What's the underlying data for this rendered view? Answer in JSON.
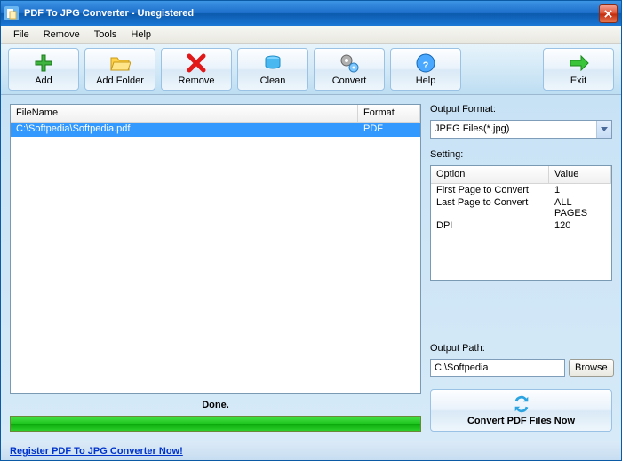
{
  "window": {
    "title": "PDF To JPG Converter - Unegistered"
  },
  "menu": {
    "file": "File",
    "remove": "Remove",
    "tools": "Tools",
    "help": "Help"
  },
  "toolbar": {
    "add": "Add",
    "add_folder": "Add Folder",
    "remove": "Remove",
    "clean": "Clean",
    "convert": "Convert",
    "help": "Help",
    "exit": "Exit"
  },
  "filelist": {
    "col_filename": "FileName",
    "col_format": "Format",
    "rows": [
      {
        "name": "C:\\Softpedia\\Softpedia.pdf",
        "format": "PDF"
      }
    ]
  },
  "status": "Done.",
  "output_format": {
    "label": "Output Format:",
    "value": "JPEG Files(*.jpg)"
  },
  "setting": {
    "label": "Setting:",
    "col_option": "Option",
    "col_value": "Value",
    "rows": [
      {
        "option": "First Page to Convert",
        "value": "1"
      },
      {
        "option": "Last Page to Convert",
        "value": "ALL PAGES"
      },
      {
        "option": "DPI",
        "value": "120"
      }
    ]
  },
  "output_path": {
    "label": "Output Path:",
    "value": "C:\\Softpedia",
    "browse": "Browse"
  },
  "convert_now": "Convert PDF Files Now",
  "footer_link": "Register PDF To JPG Converter Now!"
}
